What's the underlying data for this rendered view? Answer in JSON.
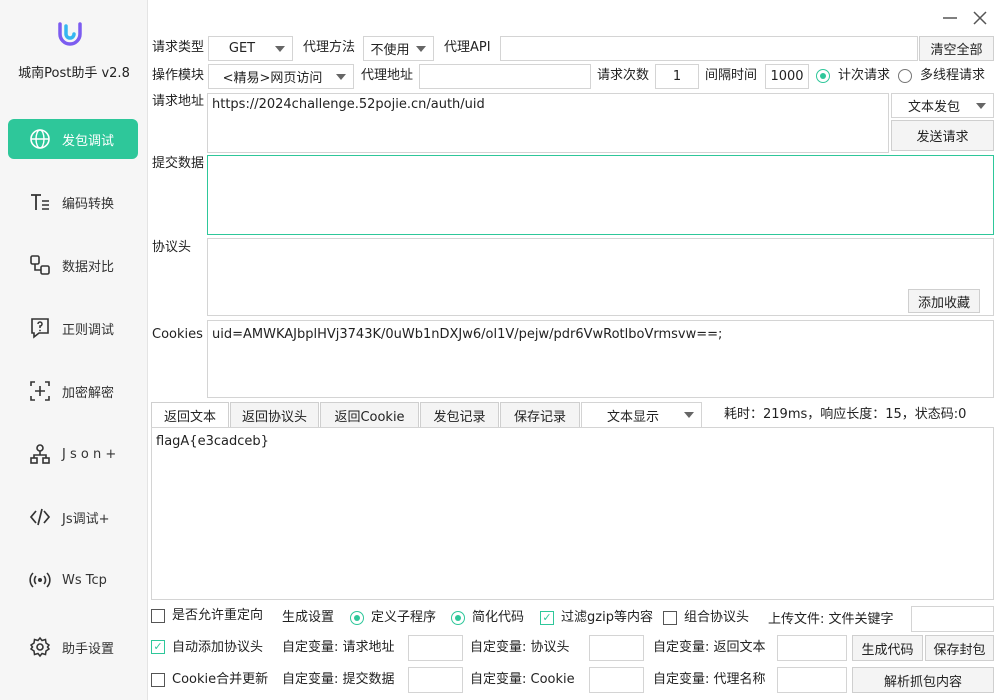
{
  "app": {
    "title": "城南Post助手 v2.8"
  },
  "sidebar": {
    "items": [
      {
        "label": "发包调试",
        "icon": "globe-icon",
        "active": true
      },
      {
        "label": "编码转换",
        "icon": "text-format-icon"
      },
      {
        "label": "数据对比",
        "icon": "compare-icon"
      },
      {
        "label": "正则调试",
        "icon": "regex-help-icon"
      },
      {
        "label": "加密解密",
        "icon": "encrypt-icon"
      },
      {
        "label": "J s o n +",
        "icon": "json-tree-icon"
      },
      {
        "label": "Js调试+",
        "icon": "code-icon"
      },
      {
        "label": "Ws Tcp",
        "icon": "broadcast-icon"
      },
      {
        "label": "助手设置",
        "icon": "gear-icon"
      }
    ]
  },
  "request": {
    "type_label": "请求类型",
    "type_value": "GET",
    "proxy_method_label": "代理方法",
    "proxy_method_value": "不使用",
    "proxy_api_label": "代理API",
    "proxy_api_value": "",
    "clear_all": "清空全部",
    "module_label": "操作模块",
    "module_value": "<精易>网页访问",
    "proxy_addr_label": "代理地址",
    "proxy_addr_value": "",
    "count_label": "请求次数",
    "count_value": "1",
    "interval_label": "间隔时间",
    "interval_value": "1000",
    "count_mode": "计次请求",
    "thread_mode": "多线程请求",
    "url_label": "请求地址",
    "url_value": "https://2024challenge.52pojie.cn/auth/uid",
    "send_mode": "文本发包",
    "send_button": "发送请求",
    "body_label": "提交数据",
    "body_value": "",
    "headers_label": "协议头",
    "headers_value": "",
    "add_favorite": "添加收藏",
    "cookies_label": "Cookies",
    "cookies_value": "uid=AMWKAJbplHVj3743K/0uWb1nDXJw6/ol1V/pejw/pdr6VwRotlboVrmsvw==;"
  },
  "response": {
    "tabs": [
      "返回文本",
      "返回协议头",
      "返回Cookie",
      "发包记录",
      "保存记录"
    ],
    "display_mode": "文本显示",
    "status": "耗时：219ms，响应长度：15，状态码:0",
    "body": "flagA{e3cadceb}"
  },
  "options": {
    "allow_redirect": "是否允许重定向",
    "gen_settings": "生成设置",
    "define_subprogram": "定义子程序",
    "simplify_code": "简化代码",
    "filter_gzip": "过滤gzip等内容",
    "combine_headers": "组合协议头",
    "upload_file": "上传文件: 文件关键字",
    "auto_headers": "自动添加协议头",
    "var_url": "自定变量: 请求地址",
    "var_headers": "自定变量: 协议头",
    "var_return": "自定变量: 返回文本",
    "gen_code": "生成代码",
    "save_package": "保存封包",
    "cookie_merge": "Cookie合并更新",
    "var_body": "自定变量: 提交数据",
    "var_cookie": "自定变量: Cookie",
    "var_proxy": "自定变量: 代理名称",
    "parse_capture": "解析抓包内容"
  },
  "colors": {
    "accent": "#2ec79a"
  }
}
